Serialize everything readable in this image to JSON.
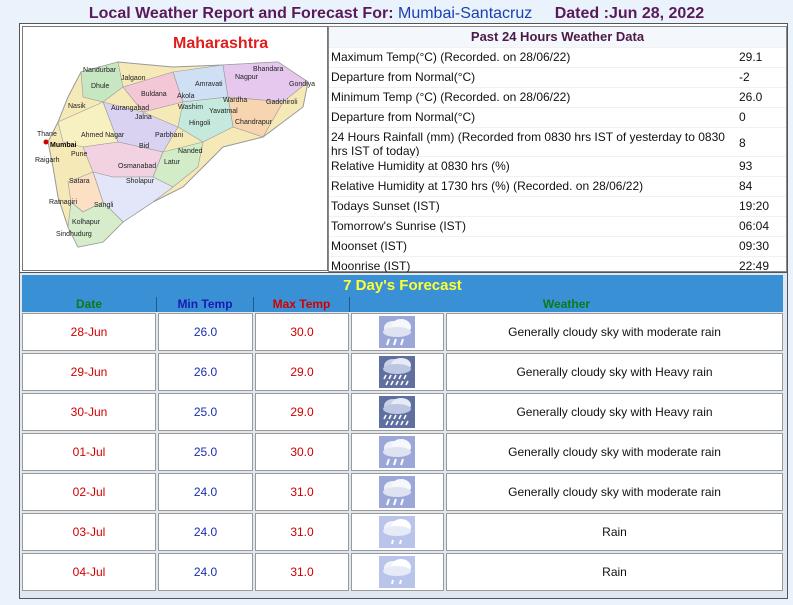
{
  "header": {
    "title": "Local Weather Report and Forecast For:",
    "location": "Mumbai-Santacruz",
    "date_label": "Dated :Jun 28, 2022"
  },
  "map": {
    "state": "Maharashtra",
    "cities": [
      "Nandurbar",
      "Dhule",
      "Jalgaon",
      "Buldana",
      "Akola",
      "Amravati",
      "Nagpur",
      "Bhandara",
      "Gondiya",
      "Washim",
      "Wardha",
      "Gadchiroli",
      "Nasik",
      "Aurangabad",
      "Jalna",
      "Hingoli",
      "Yavatmal",
      "Chandrapur",
      "Thane",
      "Mumbai",
      "Ahmed Nagar",
      "Parbhani",
      "Nanded",
      "Raigarh",
      "Pune",
      "Bid",
      "Latur",
      "Osmanabad",
      "Satara",
      "Sholapur",
      "Ratnagiri",
      "Sangli",
      "Kolhapur",
      "Sindhudurg"
    ]
  },
  "past24": {
    "heading": "Past 24 Hours Weather Data",
    "rows": [
      {
        "label": "Maximum Temp(°C) (Recorded. on 28/06/22)",
        "value": "29.1"
      },
      {
        "label": "Departure from Normal(°C)",
        "value": "-2"
      },
      {
        "label": "Minimum Temp (°C) (Recorded. on 28/06/22)",
        "value": "26.0"
      },
      {
        "label": "Departure from Normal(°C)",
        "value": "0"
      },
      {
        "label": "24 Hours Rainfall (mm) (Recorded from 0830 hrs IST of yesterday to 0830 hrs IST of today)",
        "value": "8"
      },
      {
        "label": "Relative Humidity at 0830 hrs (%)",
        "value": "93"
      },
      {
        "label": "Relative Humidity at 1730 hrs (%) (Recorded. on 28/06/22)",
        "value": "84"
      },
      {
        "label": "Todays Sunset (IST)",
        "value": "19:20"
      },
      {
        "label": "Tomorrow's Sunrise (IST)",
        "value": "06:04"
      },
      {
        "label": "Moonset (IST)",
        "value": "09:30"
      },
      {
        "label": "Moonrise (IST)",
        "value": "22:49"
      }
    ]
  },
  "forecast": {
    "heading": "7 Day's Forecast",
    "columns": {
      "date": "Date",
      "min": "Min Temp",
      "max": "Max Temp",
      "weather": "Weather"
    },
    "column_colors": {
      "date": "#0a7a1a",
      "min": "#1a1ab0",
      "max": "#d10000",
      "weather": "#0a7a1a"
    },
    "rows": [
      {
        "date": "28-Jun",
        "min": "26.0",
        "max": "30.0",
        "icon": "moderate-rain-icon",
        "desc": "Generally cloudy sky with moderate rain"
      },
      {
        "date": "29-Jun",
        "min": "26.0",
        "max": "29.0",
        "icon": "heavy-rain-icon",
        "desc": "Generally cloudy sky with Heavy rain"
      },
      {
        "date": "30-Jun",
        "min": "25.0",
        "max": "29.0",
        "icon": "heavy-rain-icon",
        "desc": "Generally cloudy sky with Heavy rain"
      },
      {
        "date": "01-Jul",
        "min": "25.0",
        "max": "30.0",
        "icon": "moderate-rain-icon",
        "desc": "Generally cloudy sky with moderate rain"
      },
      {
        "date": "02-Jul",
        "min": "24.0",
        "max": "31.0",
        "icon": "moderate-rain-icon",
        "desc": "Generally cloudy sky with moderate rain"
      },
      {
        "date": "03-Jul",
        "min": "24.0",
        "max": "31.0",
        "icon": "rain-icon",
        "desc": "Rain"
      },
      {
        "date": "04-Jul",
        "min": "24.0",
        "max": "31.0",
        "icon": "rain-icon",
        "desc": "Rain"
      }
    ]
  }
}
